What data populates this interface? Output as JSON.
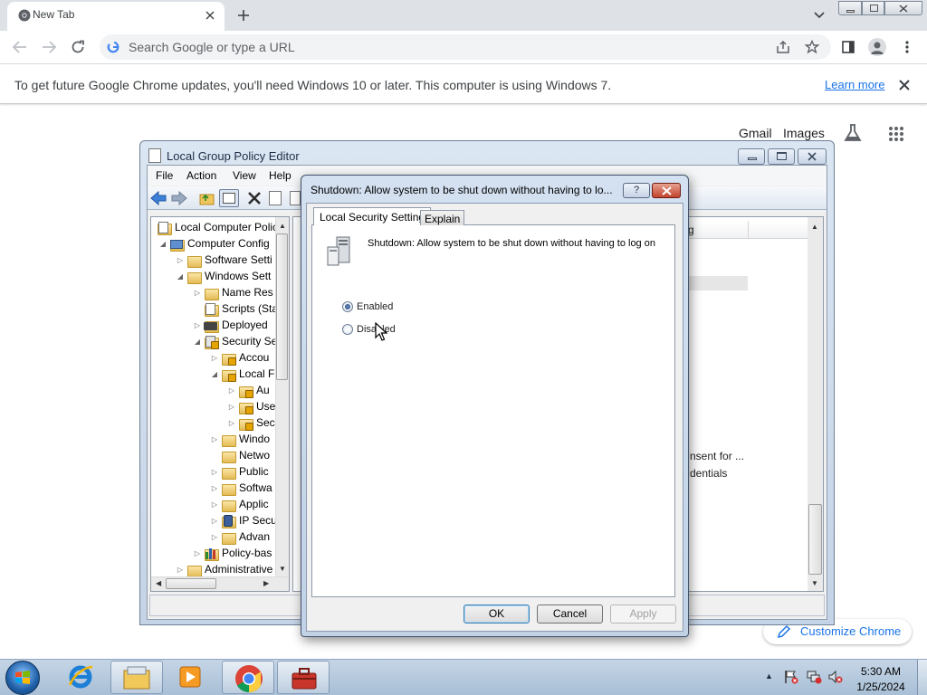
{
  "browser": {
    "tab_title": "New Tab",
    "omnibox_placeholder": "Search Google or type a URL",
    "infobar_text": "To get future Google Chrome updates, you'll need Windows 10 or later. This computer is using Windows 7.",
    "learn_more": "Learn more",
    "links": {
      "gmail": "Gmail",
      "images": "Images"
    },
    "customize_label": "Customize Chrome"
  },
  "gpedit": {
    "title": "Local Group Policy Editor",
    "menu": [
      "File",
      "Action",
      "View",
      "Help"
    ],
    "tree": [
      "Local Computer Polic",
      "Computer Config",
      "Software Setti",
      "Windows Sett",
      "Name Res",
      "Scripts (Sta",
      "Deployed",
      "Security Se",
      "Accou",
      "Local F",
      "Au",
      "Use",
      "Sec",
      "Windo",
      "Netwo",
      "Public",
      "Softwa",
      "Applic",
      "IP Secu",
      "Advan",
      "Policy-bas",
      "Administrative"
    ],
    "right_fragments": {
      "col_header": "g",
      "line1": "nsent for ...",
      "line2": "dentials"
    }
  },
  "dialog": {
    "title": "Shutdown: Allow system to be shut down without having to lo...",
    "tabs": {
      "active": "Local Security Setting",
      "other": "Explain"
    },
    "policy_name": "Shutdown: Allow system to be shut down without having to log on",
    "options": {
      "enabled": "Enabled",
      "disabled": "Disabled",
      "selected": "enabled"
    },
    "buttons": {
      "ok": "OK",
      "cancel": "Cancel",
      "apply": "Apply"
    }
  },
  "taskbar": {
    "time": "5:30 AM",
    "date": "1/25/2024"
  }
}
